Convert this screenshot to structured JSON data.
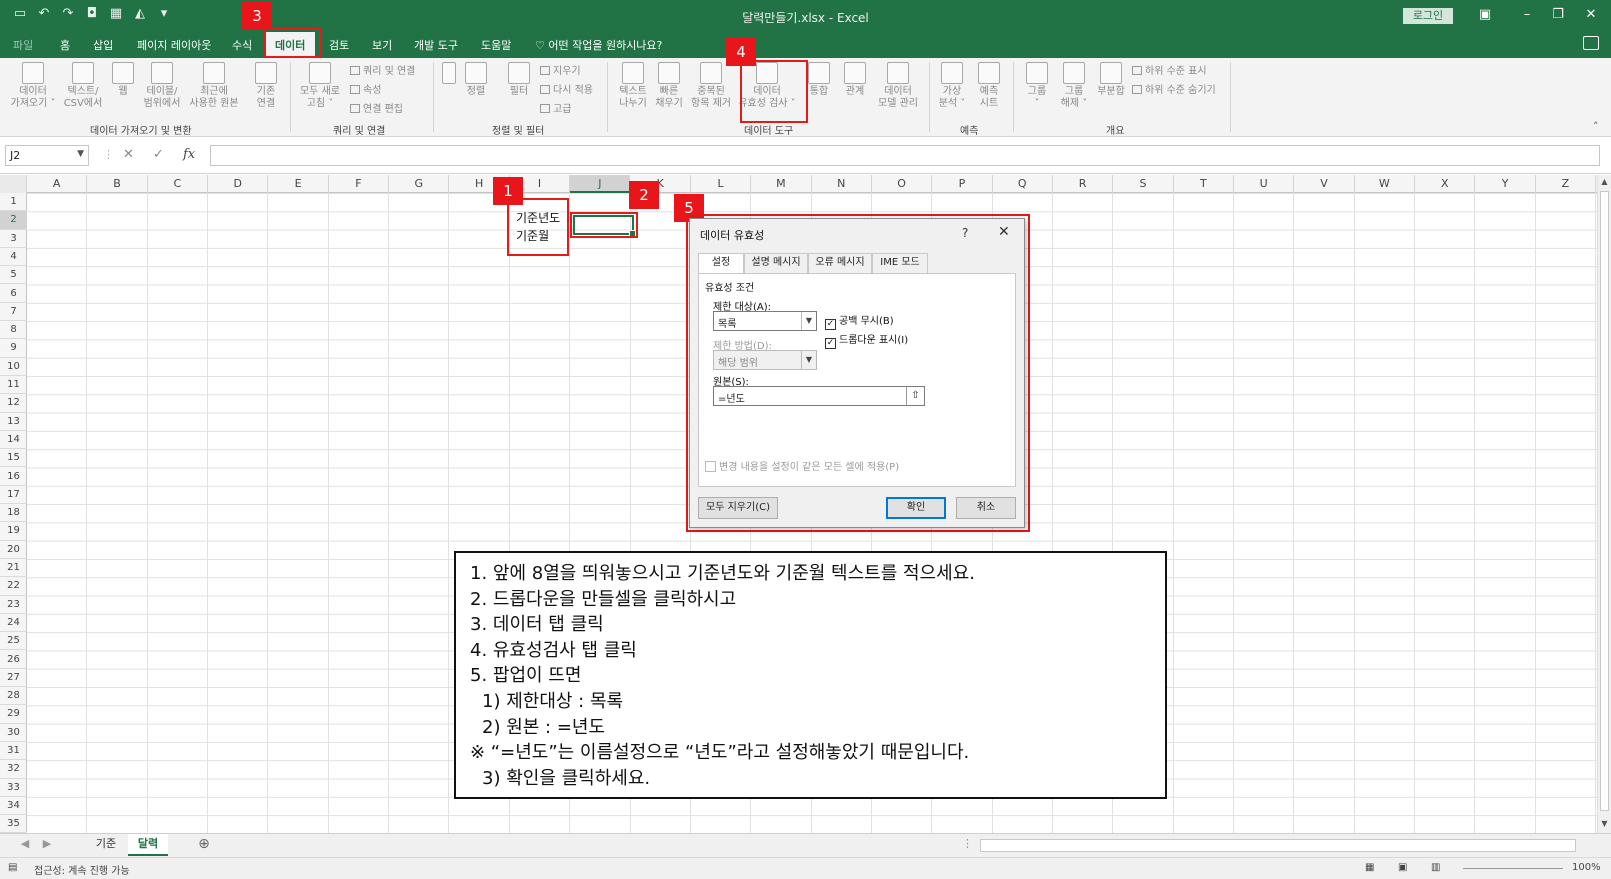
{
  "window": {
    "title": "달력만들기.xlsx  -  Excel",
    "login_label": "로그인",
    "quick_access": [
      "save-icon",
      "undo-icon",
      "redo-icon",
      "camera-icon",
      "table-icon",
      "paint-icon",
      "customize-icon"
    ]
  },
  "ribbon_tabs": [
    "파일",
    "홈",
    "삽입",
    "페이지 레이아웃",
    "수식",
    "데이터",
    "검토",
    "보기",
    "개발 도구",
    "도움말"
  ],
  "active_tab": "데이터",
  "tell_me": "어떤 작업을 원하시나요?",
  "ribbon": {
    "get_transform": {
      "label": "데이터 가져오기 및 변환",
      "buttons": [
        {
          "line1": "데이터",
          "line2": "가져오기 ˅"
        },
        {
          "line1": "텍스트/",
          "line2": "CSV에서"
        },
        {
          "line1": "웹",
          "line2": ""
        },
        {
          "line1": "테이블/",
          "line2": "범위에서"
        },
        {
          "line1": "최근에",
          "line2": "사용한 원본"
        },
        {
          "line1": "기존",
          "line2": "연결"
        }
      ]
    },
    "queries": {
      "label": "쿼리 및 연결",
      "refresh": {
        "line1": "모두 새로",
        "line2": "고침 ˅"
      },
      "small": [
        "쿼리 및 연결",
        "속성",
        "연결 편집"
      ]
    },
    "sort_filter": {
      "label": "정렬 및 필터",
      "sort": "정렬",
      "filter": "필터",
      "small": [
        "지우기",
        "다시 적용",
        "고급"
      ]
    },
    "data_tools": {
      "label": "데이터 도구",
      "buttons": [
        {
          "line1": "텍스트",
          "line2": "나누기"
        },
        {
          "line1": "빠른",
          "line2": "채우기"
        },
        {
          "line1": "중복된",
          "line2": "항목 제거"
        },
        {
          "line1": "데이터",
          "line2": "유효성 검사 ˅"
        },
        {
          "line1": "통합",
          "line2": ""
        },
        {
          "line1": "관계",
          "line2": ""
        },
        {
          "line1": "데이터",
          "line2": "모델 관리"
        }
      ]
    },
    "forecast": {
      "label": "예측",
      "buttons": [
        {
          "line1": "가상",
          "line2": "분석 ˅"
        },
        {
          "line1": "예측",
          "line2": "시트"
        }
      ]
    },
    "outline": {
      "label": "개요",
      "buttons": [
        {
          "line1": "그룹",
          "line2": "˅"
        },
        {
          "line1": "그룹",
          "line2": "해제 ˅"
        },
        {
          "line1": "부분합",
          "line2": ""
        }
      ],
      "small": [
        "하위 수준 표시",
        "하위 수준 숨기기"
      ]
    }
  },
  "formula_bar": {
    "name_box": "J2",
    "formula": ""
  },
  "columns": [
    "A",
    "B",
    "C",
    "D",
    "E",
    "F",
    "G",
    "H",
    "I",
    "J",
    "K",
    "L",
    "M",
    "N",
    "O",
    "P",
    "Q",
    "R",
    "S",
    "T",
    "U",
    "V",
    "W",
    "X",
    "Y",
    "Z"
  ],
  "selected_column": "J",
  "rows": [
    "1",
    "2",
    "3",
    "4",
    "5",
    "6",
    "7",
    "8",
    "9",
    "10",
    "11",
    "12",
    "13",
    "14",
    "15",
    "16",
    "17",
    "18",
    "19",
    "20",
    "21",
    "22",
    "23",
    "24",
    "25",
    "26",
    "27",
    "28",
    "29",
    "30",
    "31",
    "32",
    "33",
    "34",
    "35"
  ],
  "selected_row": "2",
  "cells": {
    "I2": "기준년도",
    "I3": "기준월"
  },
  "callouts": [
    "1",
    "2",
    "3",
    "4",
    "5"
  ],
  "dialog": {
    "title": "데이터 유효성",
    "help": "?",
    "close": "✕",
    "tabs": [
      "설정",
      "설명 메시지",
      "오류 메시지",
      "IME 모드"
    ],
    "section": "유효성 조건",
    "allow_label": "제한 대상(A):",
    "allow_value": "목록",
    "data_label": "제한 방법(D):",
    "data_value": "해당 범위",
    "ignore_blank": "공백 무시(B)",
    "in_cell_dropdown": "드롭다운 표시(I)",
    "source_label": "원본(S):",
    "source_value": "=년도",
    "apply_all": "변경 내용을 설정이 같은 모든 셀에 적용(P)",
    "clear_all": "모두 지우기(C)",
    "ok": "확인",
    "cancel": "취소"
  },
  "instructions": [
    "1. 앞에 8열을 띄워놓으시고 기준년도와 기준월 텍스트를 적으세요.",
    "2. 드롭다운을 만들셀을 클릭하시고",
    "3. 데이터 탭 클릭",
    "4. 유효성검사 탭 클릭",
    "5. 팝업이 뜨면",
    "  1) 제한대상 : 목록",
    "  2) 원본 : =년도",
    "※ “=년도”는 이름설정으로 “년도”라고 설정해놓았기 때문입니다.",
    "  3) 확인을 클릭하세요."
  ],
  "sheets": [
    "기준",
    "달력"
  ],
  "active_sheet": "달력",
  "status": {
    "text": "접근성: 계속 진행 가능",
    "zoom": "100%"
  },
  "colors": {
    "excel_green": "#217346",
    "callout_red": "#e8161b",
    "dialog_bg": "#f0f0f0"
  }
}
